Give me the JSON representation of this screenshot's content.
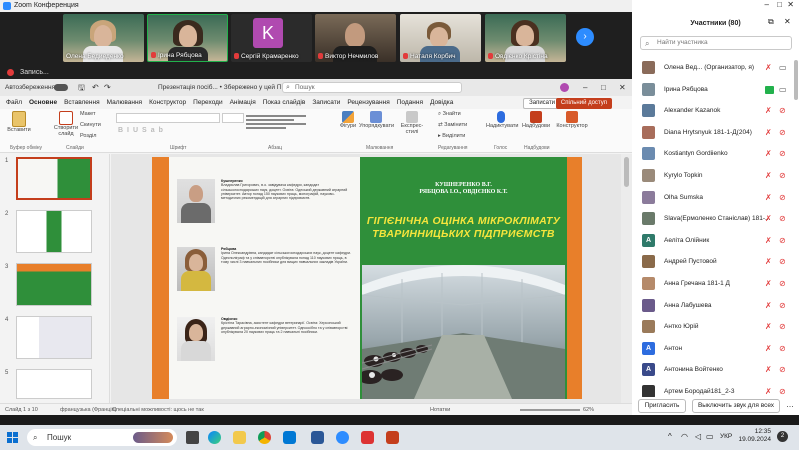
{
  "zoom": {
    "title": "Zoom Конференция",
    "recording_label": "Запись...",
    "videos": [
      {
        "name": "Олена Бедиеденко",
        "muted": false
      },
      {
        "name": "Ірина Рябцова",
        "muted": true
      },
      {
        "name": "Сергій Крамаренко",
        "muted": true,
        "avatar_letter": "K"
      },
      {
        "name": "Виктор Нечмилов",
        "muted": true
      },
      {
        "name": "Наталя Корбич",
        "muted": true
      },
      {
        "name": "Овдієнко Крістіна",
        "muted": true
      }
    ]
  },
  "ppt": {
    "doc_title": "Презентація посіб... • Збережено у цей ПК",
    "autosave_label": "Автозбереження",
    "search_placeholder": "Пошук",
    "tabs": [
      "Файл",
      "Основне",
      "Вставлення",
      "Малювання",
      "Конструктор",
      "Переходи",
      "Анімація",
      "Показ слайдів",
      "Записати",
      "Рецензування",
      "Подання",
      "Довідка"
    ],
    "active_tab": "Основне",
    "notes_button": "Записати",
    "share_button": "Спільний доступ",
    "ribbon_groups": [
      {
        "label": "Буфер обміну",
        "items": [
          "Вставити"
        ]
      },
      {
        "label": "Слайди",
        "items": [
          "Створити слайд",
          "Макет",
          "Скинути",
          "Розділ"
        ]
      },
      {
        "label": "Шрифт",
        "items": []
      },
      {
        "label": "Абзац",
        "items": []
      },
      {
        "label": "Малювання",
        "items": [
          "Фігури",
          "Упорядкувати",
          "Експрес-стилі"
        ]
      },
      {
        "label": "Редагування",
        "items": [
          "Знайти",
          "Замінити",
          "Виділити"
        ]
      },
      {
        "label": "Голос",
        "items": [
          "Надиктувати"
        ]
      },
      {
        "label": "Надбудови",
        "items": [
          "Надбудови"
        ]
      },
      {
        "label": "",
        "items": [
          "Конструктор"
        ]
      }
    ],
    "status_left": "Слайд 1 з 10",
    "status_lang": "французька (Франція)",
    "status_access": "Спеціальні можливості: щось не так",
    "notes_label": "Нотатки",
    "zoom_level": "62%",
    "slide_numbers": [
      "1",
      "2",
      "3",
      "4",
      "5"
    ]
  },
  "slide": {
    "authors": [
      {
        "name": "Кушнеренко",
        "text": "Владислав Григорович, в.о. завідувача кафедри, кандидат сільськогосподарських наук, доцент. Освіта: Одеський державний аграрний університет. Автор понад 150 наукових праць, монографій, науково-методичних рекомендацій для аграрних підприємств."
      },
      {
        "name": "Рябцова",
        "text": "Ірина Олександрівна, кандидат сільськогосподарських наук, доцент кафедри. Одесполіграф та у співавторстві опублікувала понад 110 наукових праць, в тому числі 3 навчальних посібники для вищих навчальних закладів України."
      },
      {
        "name": "Овдієнко",
        "text": "Крістіна Тарасівна, асистент кафедри ветеринарії. Освіта: Херсонський державний аграрно-економічний університет. Одноосібно та у співавторстві опублікувала 20 наукових праць та 2 навчальні посібники."
      }
    ],
    "book_authors_line1": "КУШНЕРЕНКО В.Г.",
    "book_authors_line2": "РЯБЦОВА І.О., ОВДІЄНКО К.Т.",
    "book_title": "ГІГІЄНІЧНА ОЦІНКА МІКРОКЛІМАТУ ТВАРИННИЦЬКИХ ПІДПРИЄМСТВ"
  },
  "participants": {
    "header": "Участники (80)",
    "search_placeholder": "Найти участника",
    "list": [
      {
        "name": "Олена Вед... (Организатор, я)",
        "av": "#8a6b5a",
        "mic": "off",
        "cam": "on"
      },
      {
        "name": "Ірина Рябцова",
        "av": "#7a8e9a",
        "mic": "on",
        "cam": "on"
      },
      {
        "name": "Alexander Kazanok",
        "av": "#5b7a9a",
        "mic": "off",
        "cam": "off"
      },
      {
        "name": "Diana Hrytsnyuk 181-1-Д(204)",
        "av": "#a86d5b",
        "mic": "off",
        "cam": "off"
      },
      {
        "name": "Kostiantyn Gordiienko",
        "av": "#6b8bb0",
        "mic": "off",
        "cam": "off"
      },
      {
        "name": "Kyrylo Topkin",
        "av": "#9a8a7a",
        "mic": "off",
        "cam": "off"
      },
      {
        "name": "Olha Sumska",
        "av": "#8b7b9b",
        "mic": "off",
        "cam": "off"
      },
      {
        "name": "Slava(Ермоленко Станіслав) 181-...",
        "av": "#6a7a6a",
        "mic": "off",
        "cam": "off"
      },
      {
        "name": "Аеліта Олійник",
        "av": "#2f7a6a",
        "letter": "A",
        "mic": "off",
        "cam": "off"
      },
      {
        "name": "Андрей Пустовой",
        "av": "#8a6a4a",
        "mic": "off",
        "cam": "off"
      },
      {
        "name": "Анна Гречана 181-1 Д",
        "av": "#b58a6a",
        "mic": "off",
        "cam": "off"
      },
      {
        "name": "Анна Лабушева",
        "av": "#6a5a8a",
        "mic": "off",
        "cam": "off"
      },
      {
        "name": "Антко Юрій",
        "av": "#9a7a5a",
        "mic": "off",
        "cam": "off"
      },
      {
        "name": "Антон",
        "av": "#2d6cdf",
        "letter": "A",
        "mic": "off",
        "cam": "off"
      },
      {
        "name": "Антонина Войтенко",
        "av": "#3a4a8a",
        "letter": "A",
        "mic": "off",
        "cam": "off"
      },
      {
        "name": "Артем Бородай181_2-3",
        "av": "#333333",
        "mic": "off",
        "cam": "off"
      }
    ],
    "invite_button": "Пригласить",
    "mute_all_button": "Выключить звук для всех"
  },
  "taskbar": {
    "search_label": "Пошук",
    "lang": "УКР",
    "time": "12:35",
    "date": "19.09.2024"
  },
  "colors": {
    "ppt_accent": "#c43e1c",
    "zoom_blue": "#2d8cff",
    "slide_orange": "#e87f2a",
    "slide_green": "#2f8f3a",
    "title_yellow": "#f6e53c"
  }
}
